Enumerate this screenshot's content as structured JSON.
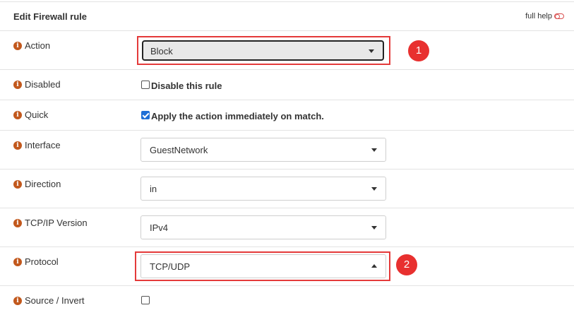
{
  "header": {
    "title": "Edit Firewall rule",
    "help_label": "full help"
  },
  "rows": {
    "action": {
      "label": "Action",
      "value": "Block",
      "badge": "1"
    },
    "disabled": {
      "label": "Disabled",
      "checkbox_label": "Disable this rule",
      "checked": false
    },
    "quick": {
      "label": "Quick",
      "checkbox_label": "Apply the action immediately on match.",
      "checked": true
    },
    "interface": {
      "label": "Interface",
      "value": "GuestNetwork"
    },
    "direction": {
      "label": "Direction",
      "value": "in"
    },
    "tcpip": {
      "label": "TCP/IP Version",
      "value": "IPv4"
    },
    "protocol": {
      "label": "Protocol",
      "value": "TCP/UDP",
      "badge": "2"
    },
    "source_invert": {
      "label": "Source / Invert",
      "checked": false
    }
  },
  "colors": {
    "info_icon": "#c2581c",
    "highlight": "#e43a3a",
    "badge": "#e8302f",
    "checkbox_checked": "#1f6fd6"
  },
  "icons": [
    "info-icon",
    "toggle-icon",
    "caret-down-icon",
    "caret-up-icon",
    "checkbox-icon"
  ]
}
